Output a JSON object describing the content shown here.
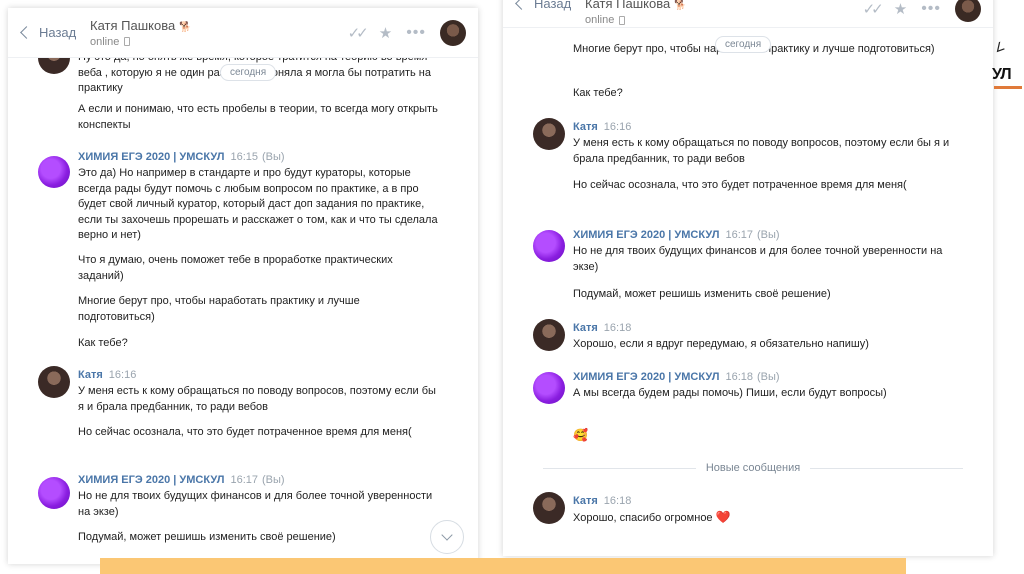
{
  "left": {
    "header": {
      "back": "Назад",
      "name": "Катя Пашкова",
      "status": "online"
    },
    "day_pill": "сегодня",
    "messages": [
      {
        "text": "Ну это да, но опять же время, которое тратится на теорию во время веба , которую я не один раз уже прогоняла я могла бы потратить на практику"
      },
      {
        "text": "А если и понимаю, что есть пробелы в теории, то всегда могу открыть конспекты"
      },
      {
        "author": "ХИМИЯ ЕГЭ 2020 | УМСКУЛ",
        "time": "16:15",
        "you": "(Вы)",
        "text": "Это да) Но например в стандарте и про будут кураторы, которые всегда рады будут помочь с любым вопросом по практике, а в про будет свой личный куратор, который даст доп задания по практике, если ты захочешь прорешать и расскажет о том, как и что ты сделала верно и нет)"
      },
      {
        "text": "Что я думаю, очень поможет тебе в проработке практических заданий)"
      },
      {
        "text": "Многие берут про, чтобы наработать практику и лучше подготовиться)"
      },
      {
        "text": "Как тебе?"
      },
      {
        "author": "Катя",
        "time": "16:16",
        "text": "У меня есть к кому обращаться по поводу вопросов, поэтому если бы я и брала предбанник, то ради вебов"
      },
      {
        "text": "Но сейчас осознала, что это будет потраченное время для меня("
      },
      {
        "author": "ХИМИЯ ЕГЭ 2020 | УМСКУЛ",
        "time": "16:17",
        "you": "(Вы)",
        "text": "Но не для твоих будущих финансов и для более точной уверенности на экзе)"
      },
      {
        "text": "Подумай, может решишь изменить своё решение)"
      }
    ]
  },
  "right": {
    "header": {
      "back": "Назад",
      "name": "Катя Пашкова",
      "status": "online"
    },
    "day_pill": "сегодня",
    "messages": [
      {
        "text": "Многие берут про, чтобы наработать практику и лучше подготовиться)"
      },
      {
        "text": "Как тебе?"
      },
      {
        "author": "Катя",
        "time": "16:16",
        "text": "У меня есть к кому обращаться по поводу вопросов, поэтому если бы я и брала предбанник, то ради вебов"
      },
      {
        "text": "Но сейчас осознала, что это будет потраченное время для меня("
      },
      {
        "author": "ХИМИЯ ЕГЭ 2020 | УМСКУЛ",
        "time": "16:17",
        "you": "(Вы)",
        "text": "Но не для твоих будущих финансов и для более точной уверенности на экзе)"
      },
      {
        "text": "Подумай, может решишь изменить своё решение)"
      },
      {
        "author": "Катя",
        "time": "16:18",
        "text": "Хорошо, если я вдруг передумаю, я обязательно напишу)"
      },
      {
        "author": "ХИМИЯ ЕГЭ 2020 | УМСКУЛ",
        "time": "16:18",
        "you": "(Вы)",
        "text": "А мы всегда будем рады помочь) Пиши, если будут вопросы)"
      },
      {
        "text": "🥰"
      }
    ],
    "new_messages": "Новые сообщения",
    "last": {
      "author": "Катя",
      "time": "16:18",
      "text": "Хорошо, спасибо огромное",
      "emoji": "❤️"
    }
  },
  "logo": {
    "brand": "УЛ"
  },
  "colors": {
    "link": "#4a76a8",
    "banner": "#fbc774",
    "accent_purple": "#8a1ee0"
  }
}
